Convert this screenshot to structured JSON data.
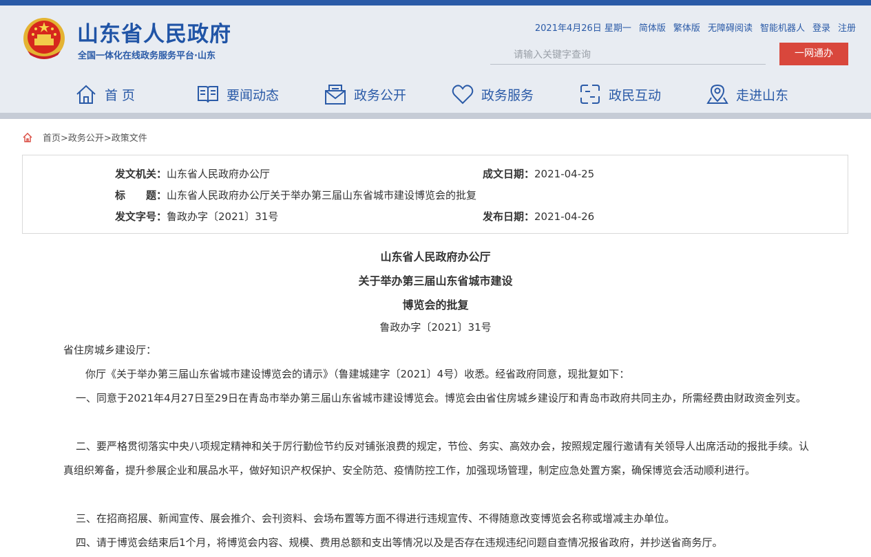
{
  "site": {
    "title": "山东省人民政府",
    "subtitle": "全国一体化在线政务服务平台·山东"
  },
  "toplinks": [
    "2021年4月26日 星期一",
    "简体版",
    "繁体版",
    "无障碍阅读",
    "智能机器人",
    "登录",
    "注册"
  ],
  "search": {
    "placeholder": "请输入关键字查询"
  },
  "onenet_label": "一网通办",
  "nav": [
    {
      "label": "首  页",
      "icon": "home-icon"
    },
    {
      "label": "要闻动态",
      "icon": "newspaper-icon"
    },
    {
      "label": "政务公开",
      "icon": "envelope-icon"
    },
    {
      "label": "政务服务",
      "icon": "heart-icon"
    },
    {
      "label": "政民互动",
      "icon": "interaction-icon"
    },
    {
      "label": "走进山东",
      "icon": "location-icon"
    }
  ],
  "breadcrumb": "首页>政务公开>政策文件",
  "info": {
    "issuer_label": "发文机关：",
    "issuer": "山东省人民政府办公厅",
    "created_label": "成文日期：",
    "created": "2021-04-25",
    "title_label": "标　　题：",
    "title": "山东省人民政府办公厅关于举办第三届山东省城市建设博览会的批复",
    "docno_label": "发文字号：",
    "docno": "鲁政办字〔2021〕31号",
    "published_label": "发布日期：",
    "published": "2021-04-26"
  },
  "doc": {
    "title_lines": [
      "山东省人民政府办公厅",
      "关于举办第三届山东省城市建设",
      "博览会的批复"
    ],
    "number": "鲁政办字〔2021〕31号",
    "addressee": "省住房城乡建设厅：",
    "paragraphs": [
      "你厅《关于举办第三届山东省城市建设博览会的请示》（鲁建城建字〔2021〕4号）收悉。经省政府同意，现批复如下：",
      "一、同意于2021年4月27日至29日在青岛市举办第三届山东省城市建设博览会。博览会由省住房城乡建设厅和青岛市政府共同主办，所需经费由财政资金列支。",
      "二、要严格贯彻落实中央八项规定精神和关于厉行勤俭节约反对铺张浪费的规定，节俭、务实、高效办会，按照规定履行邀请有关领导人出席活动的报批手续。认真组织筹备，提升参展企业和展品水平，做好知识产权保护、安全防范、疫情防控工作，加强现场管理，制定应急处置方案，确保博览会活动顺利进行。",
      "三、在招商招展、新闻宣传、展会推介、会刊资料、会场布置等方面不得进行违规宣传、不得随意改变博览会名称或增减主办单位。",
      "四、请于博览会结束后1个月，将博览会内容、规模、费用总额和支出等情况以及是否存在违规违纪问题自查情况报省政府，并抄送省商务厅。"
    ]
  },
  "colors": {
    "brand_blue": "#2a5aa7",
    "button_red": "#d9473c",
    "header_bg": "#e8ecf2"
  }
}
